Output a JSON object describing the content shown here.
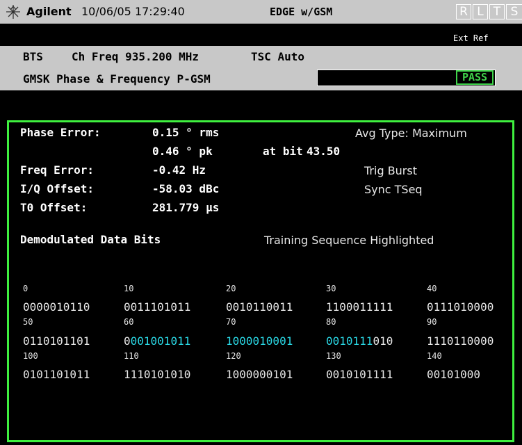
{
  "titlebar": {
    "brand": "Agilent",
    "datetime": "10/06/05 17:29:40",
    "mode": "EDGE w/GSM",
    "indicators": [
      "R",
      "L",
      "T",
      "S"
    ],
    "logo_icon": "agilent-spark-icon"
  },
  "status": {
    "ext_ref": "Ext Ref"
  },
  "info": {
    "line1_a": "BTS",
    "line1_b": "Ch Freq 935.200 MHz",
    "line1_c": "TSC Auto",
    "line2": "GMSK Phase & Frequency P-GSM",
    "result": "PASS"
  },
  "measurements": {
    "phase_error_label": "Phase Error:",
    "phase_rms": "0.15 ° rms",
    "phase_pk": "0.46 ° pk",
    "at_bit_label": "at bit",
    "at_bit_value": "43.50",
    "freq_error_label": "Freq Error:",
    "freq_error": "-0.42 Hz",
    "iq_offset_label": "I/Q Offset:",
    "iq_offset": "-58.03 dBc",
    "t0_offset_label": "T0 Offset:",
    "t0_offset": "281.779 µs",
    "avg_type": "Avg Type: Maximum",
    "trig": "Trig Burst",
    "sync": "Sync TSeq"
  },
  "demod": {
    "title": "Demodulated Data Bits",
    "note": "Training Sequence Highlighted",
    "indices": [
      "0",
      "10",
      "20",
      "30",
      "40",
      "50",
      "60",
      "70",
      "80",
      "90",
      "100",
      "110",
      "120",
      "130",
      "140"
    ],
    "row1": [
      "0000010110",
      "0011101011",
      "0010110011",
      "1100011111",
      "0111010000"
    ],
    "row2_c1": "0110101101",
    "row2_c2_pre": "0",
    "row2_c2_hl": "001001011",
    "row2_c3_hl": "1000010001",
    "row2_c4_hl": "0010111",
    "row2_c4_post": "010",
    "row2_c5": "1110110000",
    "row3": [
      "0101101011",
      "1110101010",
      "1000000101",
      "0010101111",
      "00101000"
    ]
  },
  "colors": {
    "pass": "#3fd24a",
    "panel_border": "#3ff03f",
    "highlight": "#2ad9e6",
    "bar": "#c8c8c8"
  }
}
